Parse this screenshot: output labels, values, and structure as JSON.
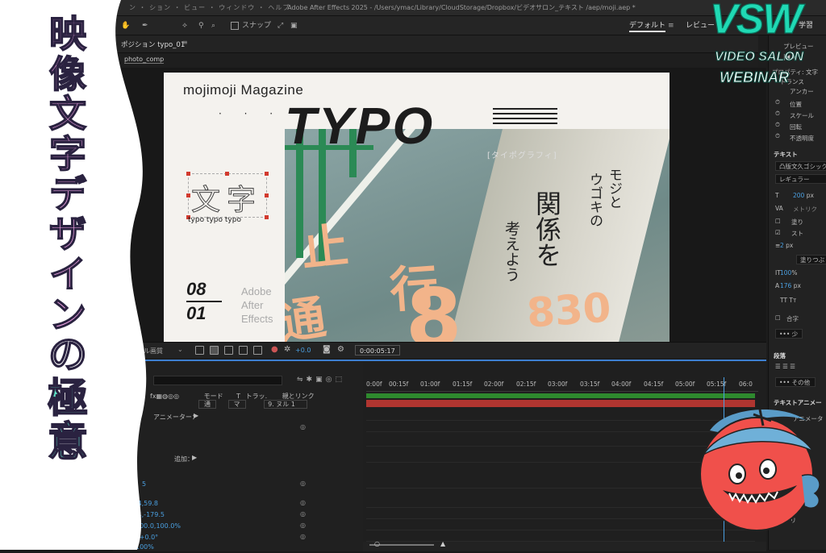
{
  "app": {
    "title": "Adobe After Effects 2025 - /Users/ymac/Library/CloudStorage/Dropbox/ビデオサロン_テキスト /aep/moji.aep *",
    "menus": "ン  ・  ション  ・  ビュー  ・  ウィンドウ  ・  ヘルプ"
  },
  "toolbar": {
    "snap_label": "スナップ",
    "workspace_default": "デフォルト",
    "workspace_review": "レビュー",
    "workspace_learn": "学習"
  },
  "composition": {
    "panel_title": "ポジション typo_01",
    "sub_tab": "photo_comp",
    "quality": "フル画質",
    "exposure": "+0.0",
    "timecode": "0:00:05:17"
  },
  "canvas": {
    "magazine_title": "mojimoji Magazine",
    "dots": "· · ·",
    "big_word": "TYPO",
    "reading": "[タイポグラフィ]",
    "kanji": "文字",
    "typo_row": "typo typo typo",
    "date_top": "08",
    "date_bottom": "01",
    "ae_line1": "Adobe",
    "ae_line2": "After",
    "ae_line3": "Effects",
    "v_col1": "モジと",
    "v_col2": "ウゴキの",
    "v_col3": "関係を",
    "v_col4": "考えよう",
    "road_chars": [
      "止",
      "通",
      "行",
      "830",
      "8"
    ]
  },
  "timeline": {
    "col_mode": "モード",
    "col_t": "T",
    "col_track": "トラッ.",
    "col_parent": "親とリンク",
    "mode_value": "通",
    "matte_value": "マ",
    "parent_value": "9. ヌル 1",
    "animator_label": "アニメーター：",
    "add_label": "追加：",
    "values": [
      "5",
      ".4,59.8",
      ".4,-179.5",
      "100.0,100.0%",
      "x+0.0°",
      "100%"
    ],
    "ticks": [
      "0:00f",
      "00:15f",
      "01:00f",
      "01:15f",
      "02:00f",
      "02:15f",
      "03:00f",
      "03:15f",
      "04:00f",
      "04:15f",
      "05:00f",
      "05:15f",
      "06:0"
    ]
  },
  "right_panel": {
    "preview": "プレビュー",
    "props_title": "プロパティ: 文字",
    "transform": "トランス",
    "anchor": "アンカー",
    "position": "位置",
    "scale": "スケール",
    "rotation": "回転",
    "opacity": "不透明度",
    "text_section": "テキスト",
    "font_family": "凸版文久ゴシック",
    "font_style": "レギュラー",
    "font_size": "200",
    "font_size_unit": "px",
    "tracking_label": "メトリク",
    "fill_label": "塗り",
    "stroke_label": "スト",
    "stroke_width": "2",
    "stroke_unit": "px",
    "fill_over": "塗りつぶ",
    "vert_scale": "100",
    "vert_scale_unit": "%",
    "baseline": "176",
    "baseline_unit": "px",
    "tt": "TT  Tт",
    "ligature": "合字",
    "more": "••• 少",
    "paragraph": "段落",
    "others": "••• その他",
    "text_animator": "テキストアニメー",
    "animator_item": "アニメータ",
    "preset": "ト＆プリ"
  },
  "overlay": {
    "vertical_title_chars": [
      "映",
      "像",
      "文",
      "字",
      "デ",
      "ザ",
      "イ",
      "ン",
      "の",
      "極",
      "意"
    ],
    "logo_big": "VSW",
    "logo_line1": "VIDEO SALON",
    "logo_line2": "WEBINAR"
  }
}
